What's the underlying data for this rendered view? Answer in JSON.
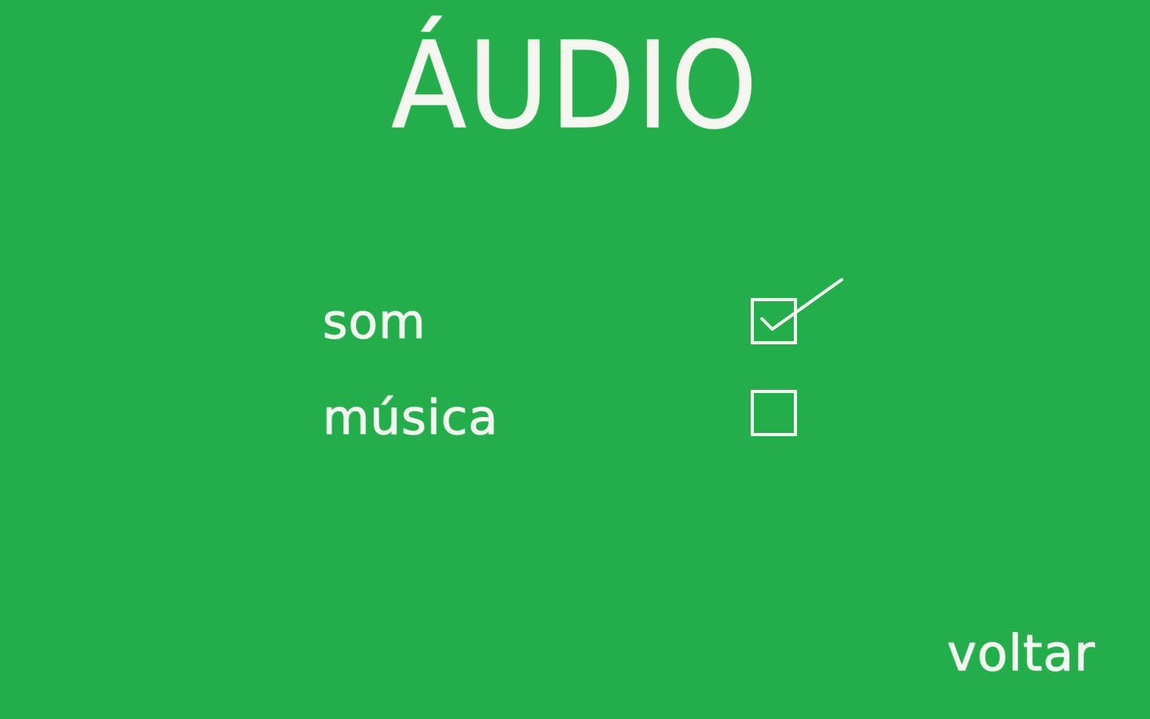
{
  "screen": {
    "title": "ÁUDIO",
    "background_color": "#23ae4b",
    "chalk_color": "#f5f6ef"
  },
  "options": [
    {
      "label": "som",
      "checked": true
    },
    {
      "label": "música",
      "checked": false
    }
  ],
  "navigation": {
    "back_label": "voltar"
  }
}
